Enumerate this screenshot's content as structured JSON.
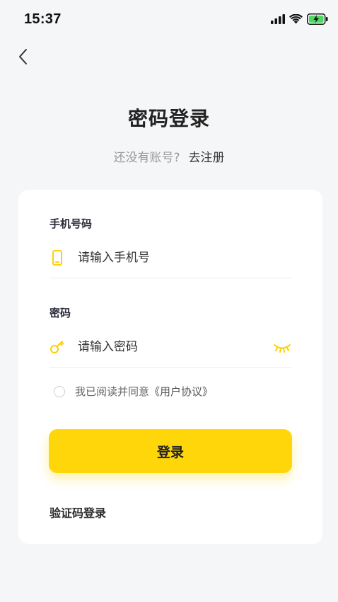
{
  "status_bar": {
    "time": "15:37",
    "icons": [
      "signal-icon",
      "wifi-icon",
      "battery-charging-icon"
    ],
    "battery_color": "#4cd964"
  },
  "nav": {
    "back_icon": "chevron-left-icon"
  },
  "header": {
    "title": "密码登录",
    "register_prompt": "还没有账号?",
    "register_link": "去注册"
  },
  "form": {
    "phone": {
      "label": "手机号码",
      "placeholder": "请输入手机号",
      "value": "",
      "icon": "phone-icon"
    },
    "password": {
      "label": "密码",
      "placeholder": "请输入密码",
      "value": "",
      "icon": "key-icon",
      "toggle_icon": "eye-closed-icon"
    },
    "agreement": {
      "checked": false,
      "text": "我已阅读并同意",
      "link": "《用户协议》"
    },
    "submit_label": "登录",
    "alt_login_label": "验证码登录"
  },
  "colors": {
    "accent": "#ffd60a",
    "background": "#f5f6f8",
    "card": "#ffffff"
  }
}
